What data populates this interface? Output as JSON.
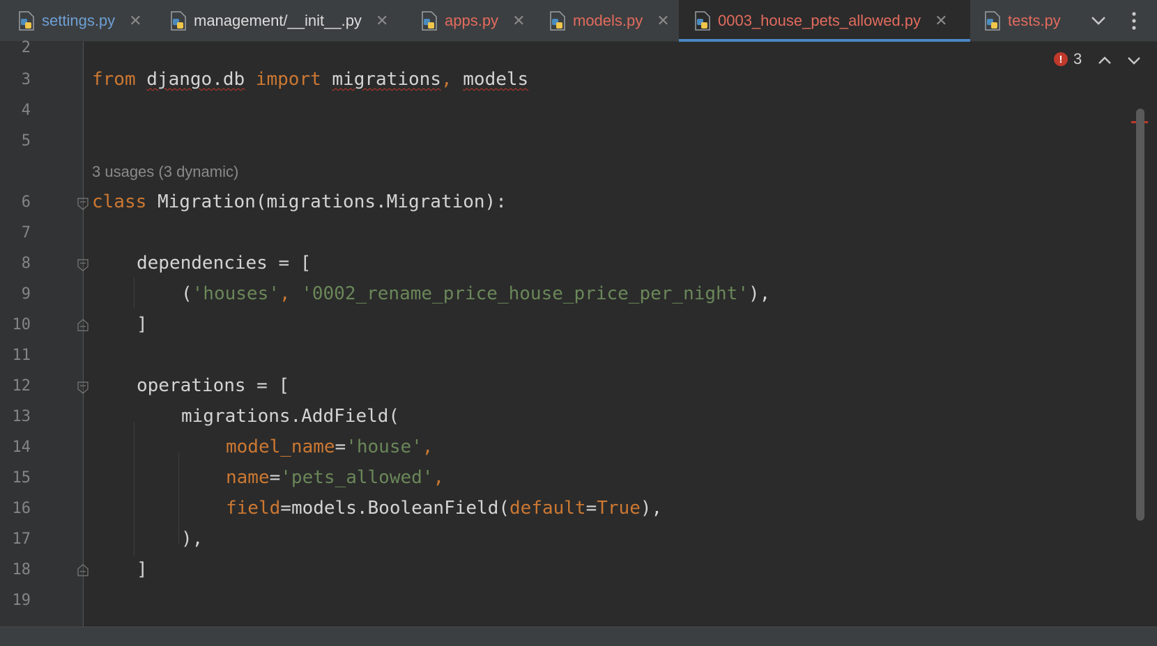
{
  "tabs": [
    {
      "label": "settings.py",
      "color": "blue",
      "active": false
    },
    {
      "label": "management/__init__.py",
      "color": "white",
      "active": false
    },
    {
      "label": "apps.py",
      "color": "red",
      "active": false
    },
    {
      "label": "models.py",
      "color": "red",
      "active": false
    },
    {
      "label": "0003_house_pets_allowed.py",
      "color": "red",
      "active": true
    },
    {
      "label": "tests.py",
      "color": "red",
      "active": false
    }
  ],
  "tab_close_glyph": "✕",
  "inspections": {
    "error_count": "3",
    "error_icon": "!"
  },
  "editor": {
    "line_numbers": [
      "2",
      "3",
      "4",
      "5",
      "6",
      "7",
      "8",
      "9",
      "10",
      "11",
      "12",
      "13",
      "14",
      "15",
      "16",
      "17",
      "18",
      "19"
    ],
    "usage_hint": "3 usages (3 dynamic)",
    "code": {
      "l3": {
        "from": "from",
        "module": "django.db",
        "import": "import",
        "name1": "migrations",
        "comma": ",",
        "name2": "models"
      },
      "l6": {
        "kw": "class",
        "rest": "Migration(migrations.Migration):"
      },
      "l8": "dependencies = [",
      "l9": {
        "open": "(",
        "s1": "'houses'",
        "comma": ", ",
        "s2": "'0002_rename_price_house_price_per_night'",
        "close": "),"
      },
      "l10": "]",
      "l12": "operations = [",
      "l13": "migrations.AddField(",
      "l14": {
        "param": "model_name",
        "eq": "=",
        "val": "'house'",
        "comma": ","
      },
      "l15": {
        "param": "name",
        "eq": "=",
        "val": "'pets_allowed'",
        "comma": ","
      },
      "l16": {
        "param": "field",
        "eq": "=",
        "call": "models.BooleanField(",
        "param2": "default",
        "eq2": "=",
        "val": "True",
        "close": "),"
      },
      "l17": "),",
      "l18": "]"
    }
  },
  "colors": {
    "background": "#2b2b2b",
    "keyword": "#cc7832",
    "string": "#6a8759",
    "error": "#c0392b",
    "active_tab_underline": "#4a88c7"
  }
}
